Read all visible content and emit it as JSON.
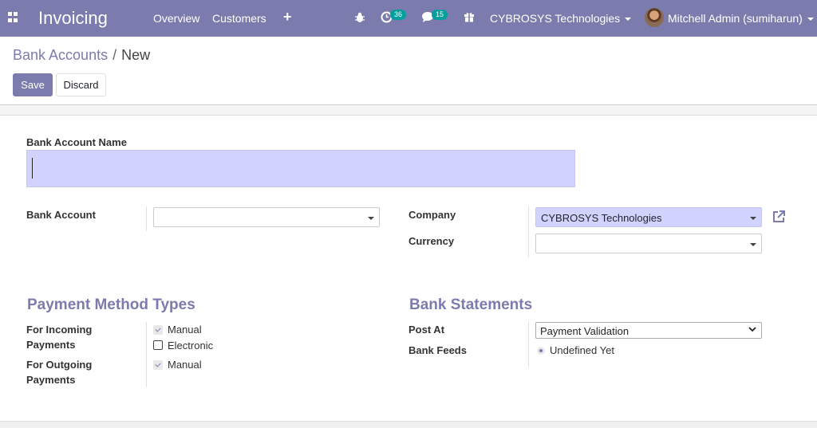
{
  "navbar": {
    "app_title": "Invoicing",
    "menu": [
      "Overview",
      "Customers"
    ],
    "activity_count": "36",
    "message_count": "15",
    "company": "CYBROSYS Technologies",
    "user": "Mitchell Admin (sumiharun)"
  },
  "breadcrumb": {
    "parent": "Bank Accounts",
    "separator": "/",
    "current": "New"
  },
  "buttons": {
    "save": "Save",
    "discard": "Discard"
  },
  "form": {
    "name_label": "Bank Account Name",
    "bank_account_label": "Bank Account",
    "company_label": "Company",
    "company_value": "CYBROSYS Technologies",
    "currency_label": "Currency"
  },
  "payment_methods": {
    "title": "Payment Method Types",
    "incoming_label_1": "For Incoming",
    "incoming_label_2": "Payments",
    "outgoing_label_1": "For Outgoing",
    "outgoing_label_2": "Payments",
    "incoming_options": [
      {
        "label": "Manual",
        "checked": true
      },
      {
        "label": "Electronic",
        "checked": false
      }
    ],
    "outgoing_options": [
      {
        "label": "Manual",
        "checked": true
      }
    ]
  },
  "bank_statements": {
    "title": "Bank Statements",
    "post_at_label": "Post At",
    "post_at_value": "Payment Validation",
    "bank_feeds_label": "Bank Feeds",
    "bank_feeds_value": "Undefined Yet"
  },
  "colors": {
    "brand": "#7c7bad",
    "input_highlight": "#d2d2ff",
    "badge": "#00a09d"
  }
}
